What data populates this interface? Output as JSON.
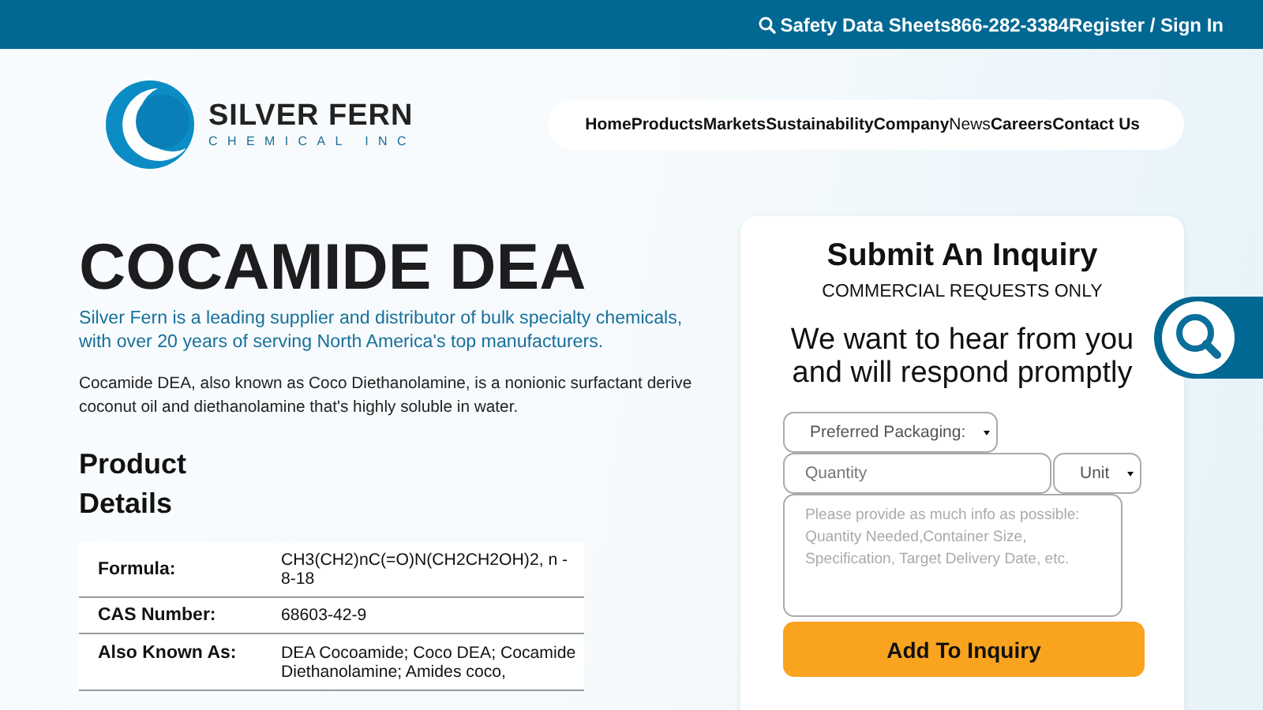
{
  "top_bar": {
    "links": [
      {
        "label": "Safety Data Sheets",
        "kind": "search"
      },
      {
        "label": "866-282-3384",
        "kind": "plain"
      },
      {
        "label": "Register / Sign In",
        "kind": "plain"
      }
    ]
  },
  "logo": {
    "name": "SILVER FERN",
    "tagline": "CHEMICAL INC"
  },
  "nav": [
    {
      "label": "Home",
      "selected": false
    },
    {
      "label": "Products",
      "selected": false
    },
    {
      "label": "Markets",
      "selected": false
    },
    {
      "label": "Sustainability",
      "selected": false
    },
    {
      "label": "Company",
      "selected": false
    },
    {
      "label": "News",
      "selected": true
    },
    {
      "label": "Careers",
      "selected": false
    },
    {
      "label": "Contact Us",
      "selected": false
    }
  ],
  "product": {
    "title": "COCAMIDE DEA",
    "intro_lines": [
      "Silver Fern is a leading supplier and distributor of bulk specialty chemicals,",
      "with over 20 years of serving North America's top manufacturers."
    ],
    "description_lines": [
      "Cocamide DEA, also known as Coco Diethanolamine, is a nonionic surfactant derive",
      "coconut oil and diethanolamine that's highly soluble in water."
    ]
  },
  "details": {
    "title_lines": [
      "Product",
      "Details"
    ],
    "rows": [
      {
        "label": "Formula:",
        "value": "CH3(CH2)nC(=O)N(CH2CH2OH)2, n - 8-18"
      },
      {
        "label": "CAS Number:",
        "value": "68603-42-9"
      },
      {
        "label": "Also Known As:",
        "value": "DEA Cocoamide; Coco DEA; Cocamide Diethanolamine; Amides coco,"
      }
    ]
  },
  "inquiry": {
    "title": "Submit An Inquiry",
    "subtitle": "COMMERCIAL REQUESTS ONLY",
    "tagline": "We want to hear from you and will respond promptly",
    "packaging": {
      "placeholder": "Preferred Packaging:"
    },
    "quantity": {
      "placeholder": "Quantity"
    },
    "unit": {
      "placeholder": "Unit"
    },
    "message": {
      "placeholder": "Please provide as much info as possible: Quantity Needed,Container Size, Specification, Target Delivery Date, etc."
    },
    "button": "Add To Inquiry"
  }
}
